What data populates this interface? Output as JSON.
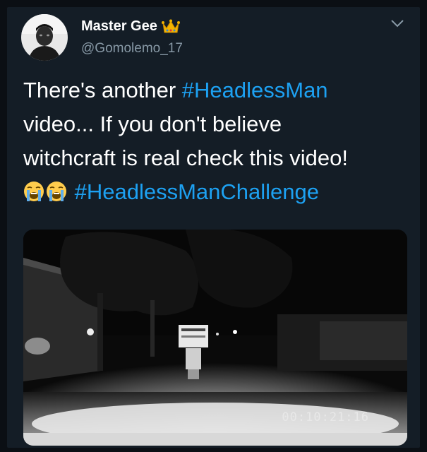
{
  "author": {
    "name": "Master Gee",
    "handle": "@Gomolemo_17",
    "badge_icon": "crown-emoji",
    "avatar_icon": "profile-photo"
  },
  "tweet": {
    "line1_text": "There's another ",
    "line1_tag": "#HeadlessMan",
    "line2_text": " video... If you don't believe",
    "line3_text": "witchcraft is real check this video!",
    "line4_emojis": [
      "loudly-crying-face",
      "loudly-crying-face"
    ],
    "line4_tag": "#HeadlessManChallenge"
  },
  "media": {
    "timecode": "00:10:21:16",
    "description_icon": "night-dashcam-video-thumbnail"
  },
  "colors": {
    "background": "#141d26",
    "text": "#ffffff",
    "secondary": "#8899a6",
    "link": "#1da1f2"
  }
}
